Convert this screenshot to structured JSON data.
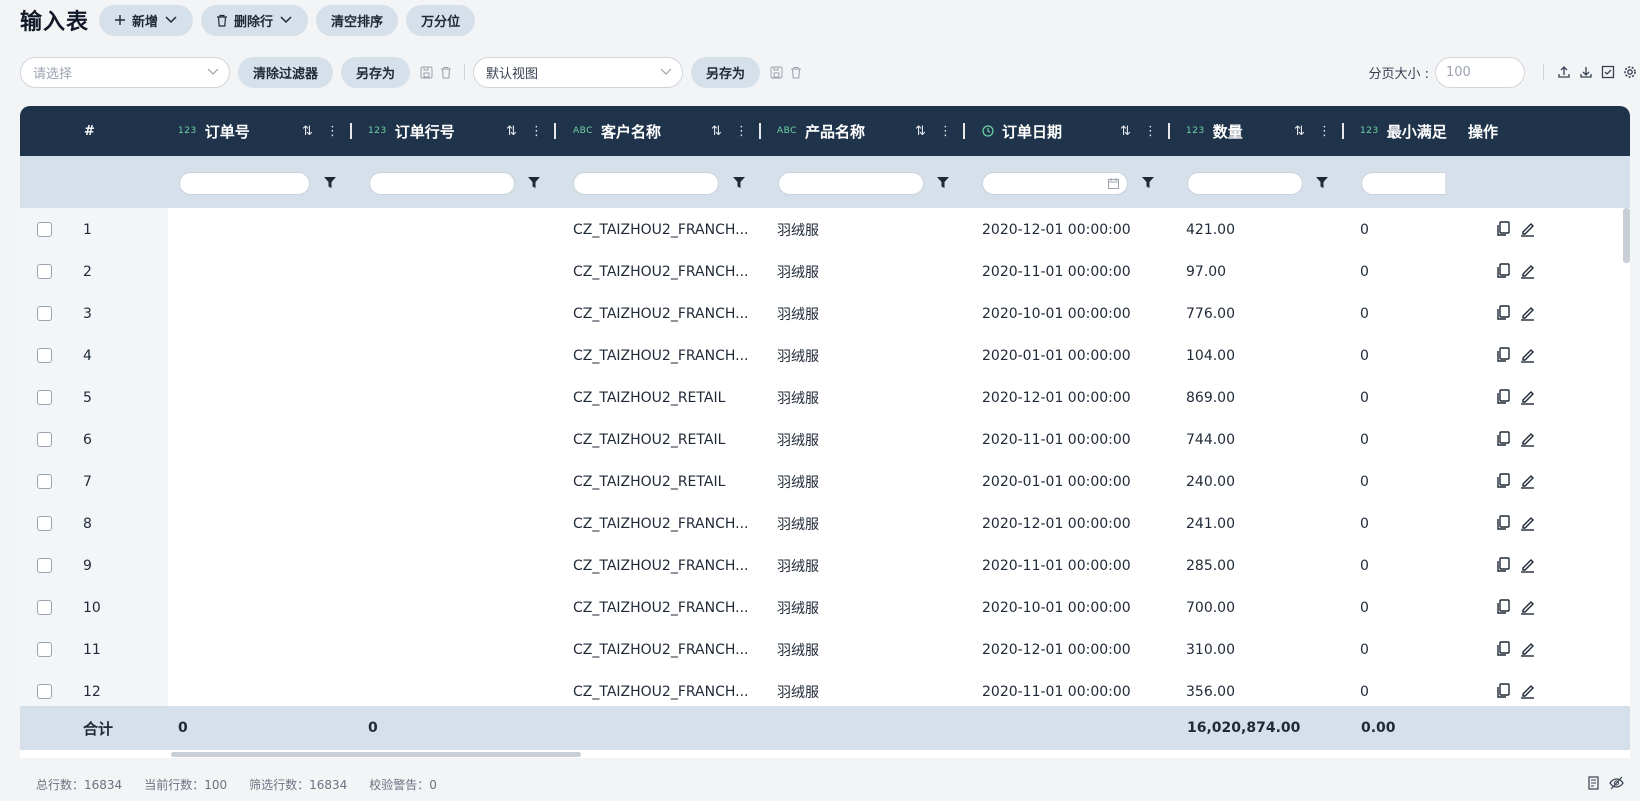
{
  "header": {
    "title": "输入表",
    "add_label": "新增",
    "delete_label": "删除行",
    "clear_sort_label": "清空排序",
    "thousands_label": "万分位"
  },
  "filterbar": {
    "select_placeholder": "请选择",
    "clear_filter_label": "清除过滤器",
    "save_as_label": "另存为",
    "view_value": "默认视图",
    "save_as_view_label": "另存为",
    "page_size_label": "分页大小 :",
    "page_size_placeholder": "100"
  },
  "table": {
    "columns": [
      {
        "label": "#",
        "type": ""
      },
      {
        "label": "订单号",
        "type": "123"
      },
      {
        "label": "订单行号",
        "type": "123"
      },
      {
        "label": "客户名称",
        "type": "ABC"
      },
      {
        "label": "产品名称",
        "type": "ABC"
      },
      {
        "label": "订单日期",
        "type": "clock"
      },
      {
        "label": "数量",
        "type": "123"
      },
      {
        "label": "最小满足",
        "type": "123"
      },
      {
        "label": "操作",
        "type": ""
      }
    ],
    "rows": [
      {
        "n": "1",
        "customer": "CZ_TAIZHOU2_FRANCH...",
        "product": "羽绒服",
        "date": "2020-12-01 00:00:00",
        "qty": "421.00",
        "min": "0"
      },
      {
        "n": "2",
        "customer": "CZ_TAIZHOU2_FRANCH...",
        "product": "羽绒服",
        "date": "2020-11-01 00:00:00",
        "qty": "97.00",
        "min": "0"
      },
      {
        "n": "3",
        "customer": "CZ_TAIZHOU2_FRANCH...",
        "product": "羽绒服",
        "date": "2020-10-01 00:00:00",
        "qty": "776.00",
        "min": "0"
      },
      {
        "n": "4",
        "customer": "CZ_TAIZHOU2_FRANCH...",
        "product": "羽绒服",
        "date": "2020-01-01 00:00:00",
        "qty": "104.00",
        "min": "0"
      },
      {
        "n": "5",
        "customer": "CZ_TAIZHOU2_RETAIL",
        "product": "羽绒服",
        "date": "2020-12-01 00:00:00",
        "qty": "869.00",
        "min": "0"
      },
      {
        "n": "6",
        "customer": "CZ_TAIZHOU2_RETAIL",
        "product": "羽绒服",
        "date": "2020-11-01 00:00:00",
        "qty": "744.00",
        "min": "0"
      },
      {
        "n": "7",
        "customer": "CZ_TAIZHOU2_RETAIL",
        "product": "羽绒服",
        "date": "2020-01-01 00:00:00",
        "qty": "240.00",
        "min": "0"
      },
      {
        "n": "8",
        "customer": "CZ_TAIZHOU2_FRANCH...",
        "product": "羽绒服",
        "date": "2020-12-01 00:00:00",
        "qty": "241.00",
        "min": "0"
      },
      {
        "n": "9",
        "customer": "CZ_TAIZHOU2_FRANCH...",
        "product": "羽绒服",
        "date": "2020-11-01 00:00:00",
        "qty": "285.00",
        "min": "0"
      },
      {
        "n": "10",
        "customer": "CZ_TAIZHOU2_FRANCH...",
        "product": "羽绒服",
        "date": "2020-10-01 00:00:00",
        "qty": "700.00",
        "min": "0"
      },
      {
        "n": "11",
        "customer": "CZ_TAIZHOU2_FRANCH...",
        "product": "羽绒服",
        "date": "2020-12-01 00:00:00",
        "qty": "310.00",
        "min": "0"
      },
      {
        "n": "12",
        "customer": "CZ_TAIZHOU2_FRANCH...",
        "product": "羽绒服",
        "date": "2020-11-01 00:00:00",
        "qty": "356.00",
        "min": "0"
      }
    ],
    "footer": {
      "label": "合计",
      "order_no_sum": "0",
      "order_line_sum": "0",
      "qty_sum": "16,020,874.00",
      "min_sum": "0.00"
    }
  },
  "status": {
    "total": "总行数：16834",
    "current": "当前行数：100",
    "filtered": "筛选行数：16834",
    "warnings": "校验警告：0"
  },
  "colors": {
    "header_bg": "#1f344b",
    "filter_bg": "#d6e0ea",
    "type_tag": "#6fd3a5"
  }
}
